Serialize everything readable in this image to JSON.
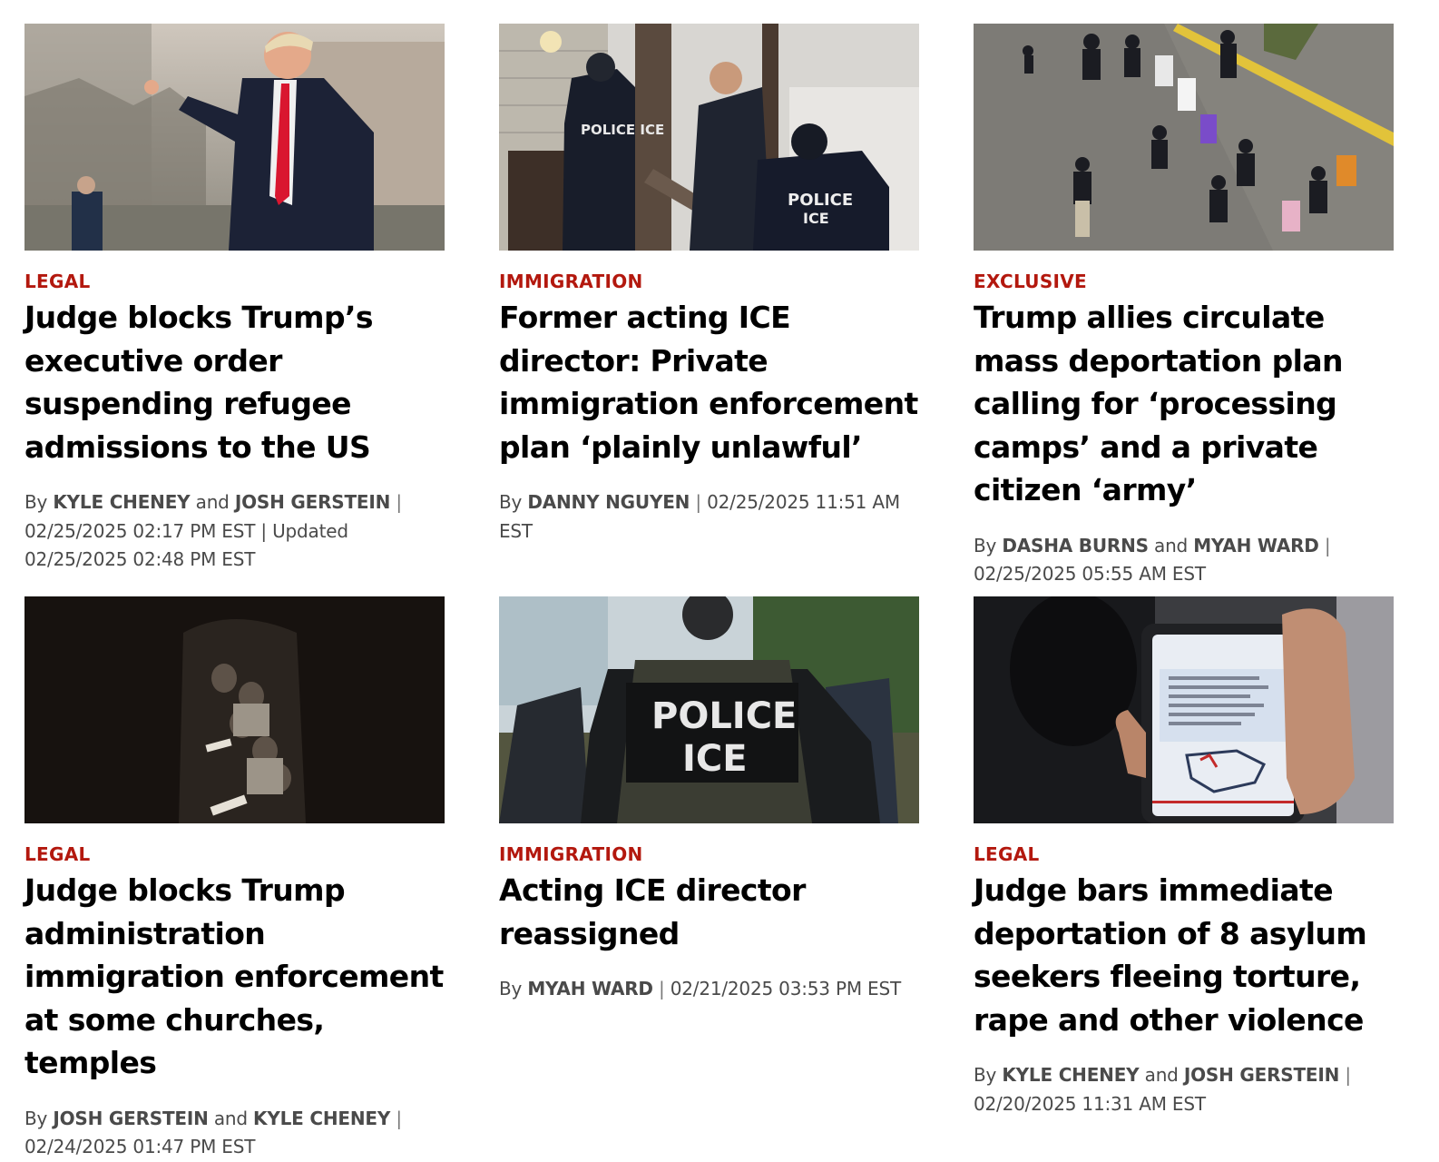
{
  "articles": [
    {
      "kicker": "LEGAL",
      "headline": "Judge blocks Trump’s executive order suspending refugee admissions to the US",
      "by": "By",
      "author1": "KYLE CHENEY",
      "and": "and",
      "author2": "JOSH GERSTEIN",
      "pipe": "|",
      "date": "02/25/2025 02:17 PM EST",
      "updated": "| Updated 02/25/2025 02:48 PM EST"
    },
    {
      "kicker": "IMMIGRATION",
      "headline": "Former acting ICE director: Private immigration enforcement plan ‘plainly unlawful’",
      "by": "By",
      "author1": "DANNY NGUYEN",
      "pipe": "|",
      "date": "02/25/2025 11:51 AM EST",
      "photo_text": "POLICE ICE"
    },
    {
      "kicker": "EXCLUSIVE",
      "headline": "Trump allies circulate mass deportation plan calling for ‘processing camps’ and a private citizen ‘army’",
      "by": "By",
      "author1": "DASHA BURNS",
      "and": "and",
      "author2": "MYAH WARD",
      "pipe": "|",
      "date": "02/25/2025 05:55 AM EST"
    },
    {
      "kicker": "LEGAL",
      "headline": "Judge blocks Trump administration immigration enforcement at some churches, temples",
      "by": "By",
      "author1": "JOSH GERSTEIN",
      "and": "and",
      "author2": "KYLE CHENEY",
      "pipe": "|",
      "date": "02/24/2025 01:47 PM EST"
    },
    {
      "kicker": "IMMIGRATION",
      "headline": "Acting ICE director reassigned",
      "by": "By",
      "author1": "MYAH WARD",
      "pipe": "|",
      "date": "02/21/2025 03:53 PM EST",
      "photo_text_1": "POLICE",
      "photo_text_2": "ICE"
    },
    {
      "kicker": "LEGAL",
      "headline": "Judge bars immediate deportation of 8 asylum seekers fleeing torture, rape and other violence",
      "by": "By",
      "author1": "KYLE CHENEY",
      "and": "and",
      "author2": "JOSH GERSTEIN",
      "pipe": "|",
      "date": "02/20/2025 11:31 AM EST"
    }
  ],
  "colors": {
    "kicker": "#b3180e",
    "byline": "#4a4a4a"
  }
}
